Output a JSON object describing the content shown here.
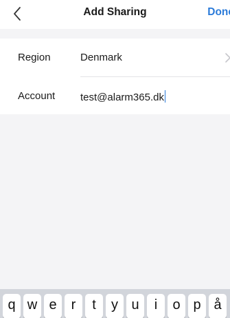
{
  "nav": {
    "title": "Add Sharing",
    "done_label": "Done",
    "back_icon": "chevron-left-icon"
  },
  "form": {
    "region": {
      "label": "Region",
      "value": "Denmark",
      "icon": "chevron-right-icon"
    },
    "account": {
      "label": "Account",
      "value": "test@alarm365.dk"
    }
  },
  "keyboard": {
    "keys": [
      "q",
      "w",
      "e",
      "r",
      "t",
      "y",
      "u",
      "i",
      "o",
      "p",
      "å"
    ]
  },
  "colors": {
    "accent": "#2b7bd9",
    "background": "#f4f4f6",
    "keyboard": "#d2d5db"
  }
}
